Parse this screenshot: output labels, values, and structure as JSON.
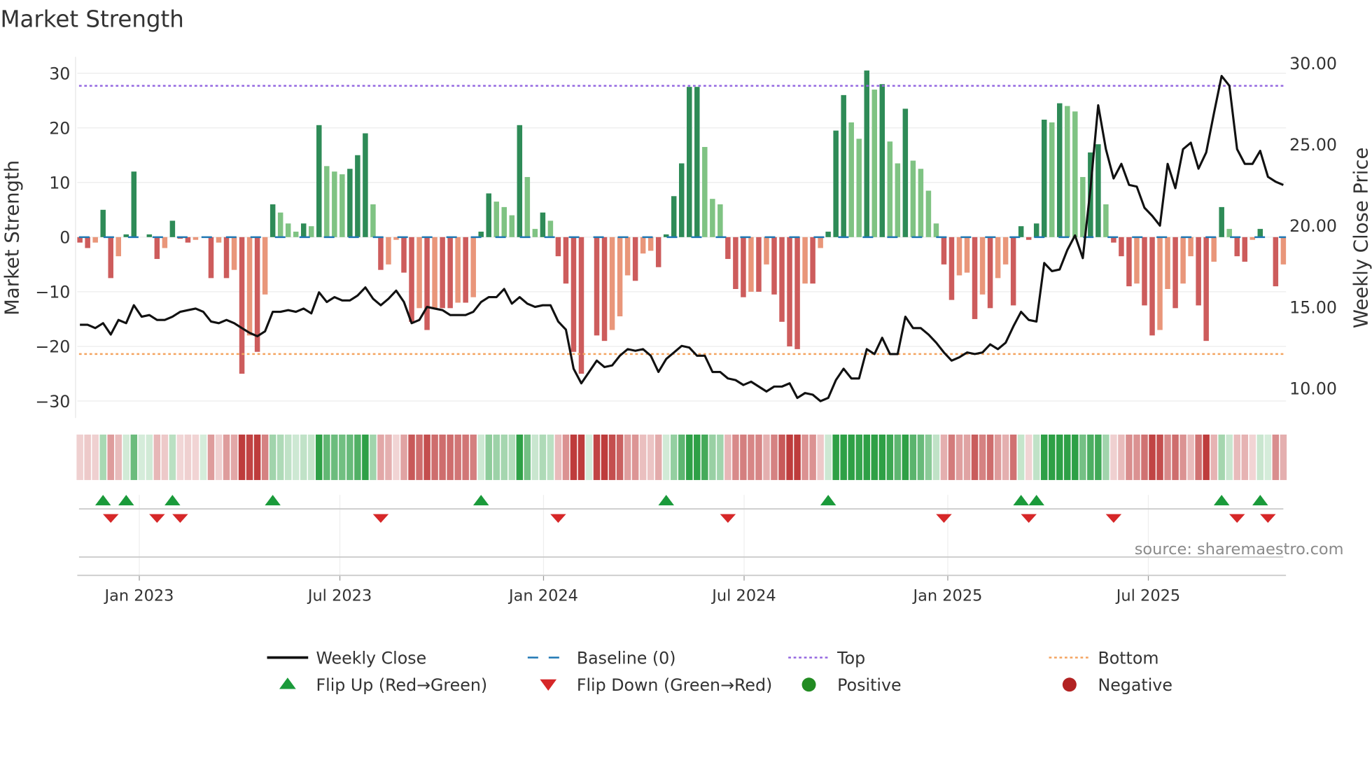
{
  "chart_data": {
    "type": "bar",
    "title": "Market Strength",
    "ylabel": "Market Strength",
    "y2label": "Weekly Close Price",
    "ylim": [
      -33.1,
      33
    ],
    "y2lim": [
      8.17,
      30.38
    ],
    "yticks": [
      30,
      20,
      10,
      0,
      -10,
      -20,
      -30
    ],
    "yticklabels": [
      "30",
      "20",
      "10",
      "0",
      "−10",
      "−20",
      "−30"
    ],
    "y2ticks": [
      30,
      25,
      20,
      15,
      10
    ],
    "y2ticklabels": [
      "30.00",
      "25.00",
      "20.00",
      "15.00",
      "10.00"
    ],
    "xticks": [
      {
        "label": "Jan 2023",
        "week": 7.7
      },
      {
        "label": "Jul 2023",
        "week": 33.7
      },
      {
        "label": "Jan 2024",
        "week": 60.1
      },
      {
        "label": "Jul 2024",
        "week": 86.1
      },
      {
        "label": "Jan 2025",
        "week": 112.5
      },
      {
        "label": "Jul 2025",
        "week": 138.5
      }
    ],
    "top_level": 27.7,
    "bottom_level": -21.4,
    "strength": [
      -1,
      -2,
      -1,
      5,
      -7.5,
      -3.5,
      0.5,
      12,
      0,
      0.5,
      -4,
      -2,
      3,
      -0.3,
      -1,
      -0.5,
      0,
      -7.5,
      -1,
      -7.5,
      -6,
      -25,
      -18,
      -21,
      -10.5,
      6,
      4.5,
      2.5,
      1,
      2.5,
      2,
      20.5,
      13,
      12,
      11.5,
      12.5,
      15,
      19,
      6,
      -6,
      -5,
      -0.5,
      -6.5,
      -15.5,
      -13,
      -17,
      -13,
      -13,
      -13,
      -12,
      -12,
      -11,
      1,
      8,
      6.5,
      5.5,
      4,
      20.5,
      11,
      1.5,
      4.5,
      3,
      -3.5,
      -8.5,
      -21,
      -25,
      0,
      -18,
      -19,
      -17,
      -14.5,
      -7,
      -8,
      -3,
      -2.5,
      -5.5,
      0.5,
      7.5,
      13.5,
      27.5,
      27.5,
      16.5,
      7,
      6,
      -4,
      -9.5,
      -11,
      -10,
      -10,
      -5,
      -10.5,
      -15.5,
      -20,
      -20.5,
      -8.5,
      -8.5,
      -2,
      1,
      19.5,
      26,
      21,
      18,
      30.5,
      27,
      28,
      17.5,
      13.5,
      23.5,
      14,
      12.5,
      8.5,
      2.5,
      -5,
      -11.5,
      -7,
      -6.5,
      -15,
      -10.5,
      -13,
      -7.5,
      -5,
      -12.5,
      2,
      -0.5,
      2.5,
      21.5,
      21,
      24.5,
      24,
      23,
      11,
      15.5,
      17,
      6,
      -1,
      -3.5,
      -9,
      -8.5,
      -12.5,
      -18,
      -17,
      -9.5,
      -13,
      -8.5,
      -3.5,
      -12.5,
      -19,
      -4.5,
      5.5,
      1.5,
      -3.5,
      -4.5,
      -0.5,
      1.5,
      0,
      -9,
      -5
    ],
    "weekly_close": [
      13.9,
      13.9,
      13.7,
      14.0,
      13.3,
      14.2,
      14.0,
      15.1,
      14.4,
      14.5,
      14.2,
      14.2,
      14.4,
      14.7,
      14.8,
      14.9,
      14.7,
      14.1,
      14.0,
      14.2,
      14.0,
      13.7,
      13.4,
      13.2,
      13.5,
      14.7,
      14.7,
      14.8,
      14.7,
      14.9,
      14.6,
      15.9,
      15.3,
      15.6,
      15.4,
      15.4,
      15.7,
      16.2,
      15.5,
      15.1,
      15.5,
      16.0,
      15.3,
      14.0,
      14.2,
      15.0,
      14.9,
      14.8,
      14.5,
      14.5,
      14.5,
      14.7,
      15.3,
      15.6,
      15.6,
      16.1,
      15.2,
      15.6,
      15.2,
      15.0,
      15.1,
      15.1,
      14.1,
      13.6,
      11.2,
      10.3,
      11.0,
      11.7,
      11.3,
      11.4,
      12.0,
      12.4,
      12.3,
      12.4,
      12.0,
      11.0,
      11.8,
      12.2,
      12.6,
      12.5,
      12.0,
      12.0,
      11.0,
      11.0,
      10.6,
      10.5,
      10.2,
      10.4,
      10.1,
      9.8,
      10.1,
      10.1,
      10.3,
      9.4,
      9.7,
      9.6,
      9.2,
      9.4,
      10.5,
      11.2,
      10.6,
      10.6,
      12.4,
      12.1,
      13.1,
      12.1,
      12.1,
      14.4,
      13.7,
      13.7,
      13.3,
      12.8,
      12.2,
      11.7,
      11.9,
      12.2,
      12.1,
      12.2,
      12.7,
      12.4,
      12.8,
      13.8,
      14.7,
      14.2,
      14.1,
      17.7,
      17.2,
      17.3,
      18.5,
      19.4,
      18.0,
      22.3,
      27.4,
      24.7,
      22.9,
      23.8,
      22.5,
      22.4,
      21.1,
      20.6,
      20.0,
      23.8,
      22.3,
      24.7,
      25.1,
      23.5,
      24.5,
      26.9,
      29.2,
      28.6,
      24.7,
      23.8,
      23.8,
      24.6,
      23.0,
      22.7,
      22.5
    ],
    "flip_up_weeks": [
      3,
      6,
      12,
      25,
      52,
      76,
      97,
      122,
      124,
      148,
      153
    ],
    "flip_down_weeks": [
      4,
      10,
      13,
      39,
      62,
      84,
      112,
      123,
      134,
      150,
      154
    ],
    "legend": [
      {
        "label": "Weekly Close",
        "kind": "line",
        "color": "#111111"
      },
      {
        "label": "Baseline (0)",
        "kind": "dash",
        "color": "#1f77b4"
      },
      {
        "label": "Top",
        "kind": "dot",
        "color": "#9467e0"
      },
      {
        "label": "Bottom",
        "kind": "dot",
        "color": "#f4a460"
      },
      {
        "label": "Flip Up (Red→Green)",
        "kind": "tri-up",
        "color": "#1a9a3a"
      },
      {
        "label": "Flip Down (Green→Red)",
        "kind": "tri-down",
        "color": "#d62728"
      },
      {
        "label": "Positive",
        "kind": "circle",
        "color": "#228b22"
      },
      {
        "label": "Negative",
        "kind": "circle",
        "color": "#b22222"
      }
    ],
    "legend_placement": "bottom",
    "colors": {
      "pos_strong": "#2e8b57",
      "pos_weak": "#7fc383",
      "neg_strong": "#cd5c5c",
      "neg_weak": "#e9967a"
    }
  },
  "source": "source: sharemaestro.com"
}
